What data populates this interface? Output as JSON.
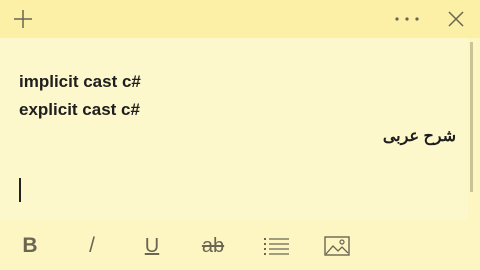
{
  "note": {
    "lines": [
      "implicit cast c#",
      "explicit cast c#",
      "شرح عربى"
    ]
  },
  "titlebar": {
    "new_icon": "plus-icon",
    "menu_icon": "more-icon",
    "close_icon": "close-icon"
  },
  "toolbar": {
    "bold_label": "B",
    "italic_label": "/",
    "underline_label": "U",
    "strike_label": "ab",
    "bullets_icon": "bullet-list-icon",
    "image_icon": "image-icon"
  },
  "colors": {
    "titlebar": "#fbf0a6",
    "note_background": "#fdf7cc",
    "icon": "#6a6652",
    "text": "#1e1e1e"
  }
}
